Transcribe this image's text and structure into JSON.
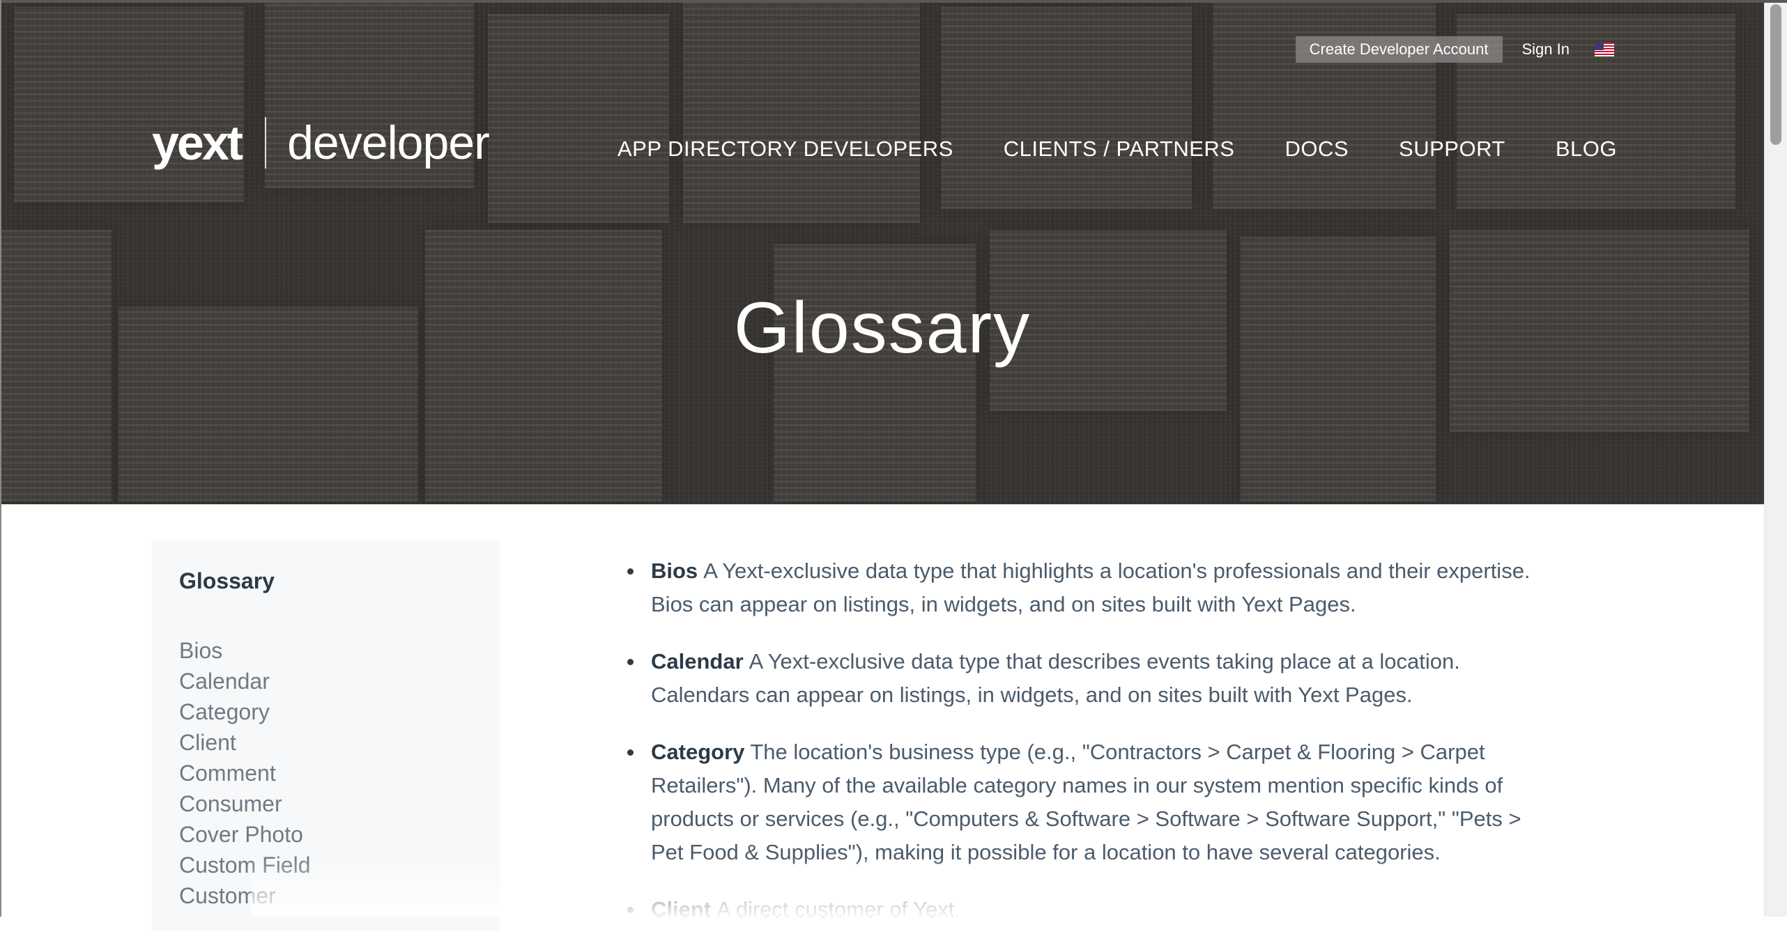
{
  "header": {
    "create_account": "Create Developer Account",
    "sign_in": "Sign In",
    "flag_icon": "us-flag-icon",
    "logo_brand": "yext",
    "logo_product": "developer",
    "nav": [
      "APP DIRECTORY DEVELOPERS",
      "CLIENTS / PARTNERS",
      "DOCS",
      "SUPPORT",
      "BLOG"
    ]
  },
  "hero": {
    "title": "Glossary"
  },
  "sidebar": {
    "title": "Glossary",
    "items": [
      "Bios",
      "Calendar",
      "Category",
      "Client",
      "Comment",
      "Consumer",
      "Cover Photo",
      "Custom Field",
      "Customer"
    ]
  },
  "glossary": {
    "entries": [
      {
        "term": "Bios",
        "definition": "A Yext-exclusive data type that highlights a location's professionals and their expertise. Bios can appear on listings, in widgets, and on sites built with Yext Pages."
      },
      {
        "term": "Calendar",
        "definition": "A Yext-exclusive data type that describes events taking place at a location. Calendars can appear on listings, in widgets, and on sites built with Yext Pages."
      },
      {
        "term": "Category",
        "definition": "The location's business type (e.g., \"Contractors > Carpet & Flooring > Carpet Retailers\"). Many of the available category names in our system mention specific kinds of products or services (e.g., \"Computers & Software > Software > Software Support,\" \"Pets > Pet Food & Supplies\"), making it possible for a location to have several categories."
      },
      {
        "term": "Client",
        "definition": "A direct customer of Yext."
      }
    ]
  },
  "colors": {
    "hero_overlay": "#4e4b48",
    "sidebar_bg": "#f7f8f9",
    "text": "#4b5b6b",
    "heading": "#2c3a47"
  }
}
